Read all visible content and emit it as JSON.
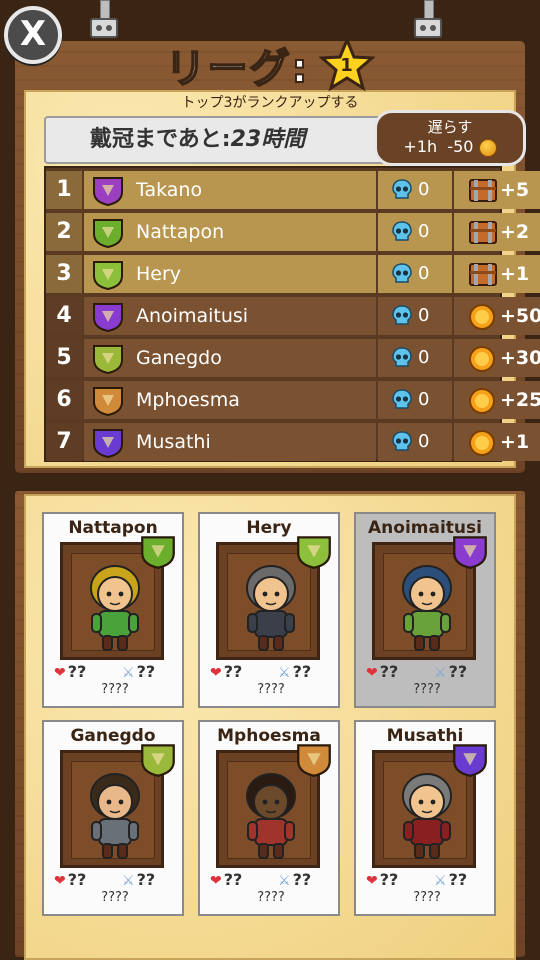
{
  "header": {
    "title": "リーグ:",
    "rank": "1",
    "subtitle": "トップ3がランクアップする",
    "countdown_label": "戴冠まであと:",
    "countdown_value": "23時間",
    "delay": {
      "label": "遅らす",
      "time": "+1h",
      "cost": "-50"
    }
  },
  "ranking": [
    {
      "rank": "1",
      "name": "Takano",
      "skulls": "0",
      "reward": "+5",
      "reward_type": "chest",
      "shield_color": "#9a3fc0",
      "tier": "top"
    },
    {
      "rank": "2",
      "name": "Nattapon",
      "skulls": "0",
      "reward": "+2",
      "reward_type": "chest",
      "shield_color": "#6aae2c",
      "tier": "top"
    },
    {
      "rank": "3",
      "name": "Hery",
      "skulls": "0",
      "reward": "+1",
      "reward_type": "chest",
      "shield_color": "#8cc03a",
      "tier": "top"
    },
    {
      "rank": "4",
      "name": "Anoimaitusi",
      "skulls": "0",
      "reward": "+50",
      "reward_type": "coin",
      "shield_color": "#8a3bd0",
      "tier": "mid"
    },
    {
      "rank": "5",
      "name": "Ganegdo",
      "skulls": "0",
      "reward": "+30",
      "reward_type": "coin",
      "shield_color": "#9ab83a",
      "tier": "mid"
    },
    {
      "rank": "6",
      "name": "Mphoesma",
      "skulls": "0",
      "reward": "+25",
      "reward_type": "coin",
      "shield_color": "#d08a3a",
      "tier": "mid"
    },
    {
      "rank": "7",
      "name": "Musathi",
      "skulls": "0",
      "reward": "+1",
      "reward_type": "coin",
      "shield_color": "#6a3bd0",
      "tier": "mid"
    }
  ],
  "cards": [
    {
      "name": "Nattapon",
      "hp": "??",
      "atk": "??",
      "unknown": "????",
      "badge_color": "#6aae2c",
      "dim": false
    },
    {
      "name": "Hery",
      "hp": "??",
      "atk": "??",
      "unknown": "????",
      "badge_color": "#8cc03a",
      "dim": false
    },
    {
      "name": "Anoimaitusi",
      "hp": "??",
      "atk": "??",
      "unknown": "????",
      "badge_color": "#8a3bd0",
      "dim": true
    },
    {
      "name": "Ganegdo",
      "hp": "??",
      "atk": "??",
      "unknown": "????",
      "badge_color": "#9ab83a",
      "dim": false
    },
    {
      "name": "Mphoesma",
      "hp": "??",
      "atk": "??",
      "unknown": "????",
      "badge_color": "#d08a3a",
      "dim": false
    },
    {
      "name": "Musathi",
      "hp": "??",
      "atk": "??",
      "unknown": "????",
      "badge_color": "#6a3bd0",
      "dim": false
    }
  ],
  "colors": {
    "parchment": "#f6df9b",
    "wood": "#6e4326",
    "top_row": "#b99650",
    "mid_row": "#7a5232"
  }
}
